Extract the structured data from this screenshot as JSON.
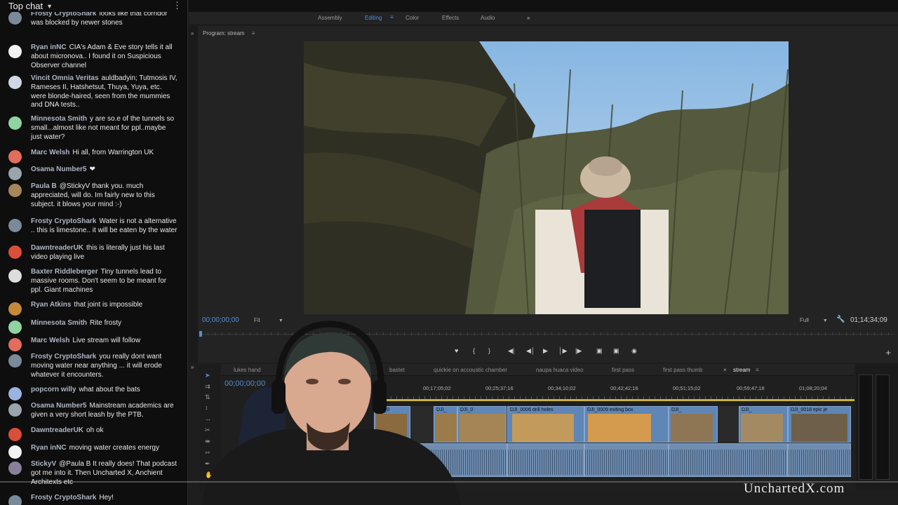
{
  "chat": {
    "header": "Top chat",
    "messages": [
      {
        "author": "Frosty CryptoShark",
        "badge": "",
        "text": "looks like that corridor was blocked by newer stones",
        "color": "#7a8a99"
      },
      {
        "author": "Ryan inNC",
        "text": "CIA's Adam & Eve story tells it all about micronova.. I found it on Suspicious Observer channel",
        "color": "#f2f2f2"
      },
      {
        "author": "Vincit Omnia Veritas",
        "text": "auldbadyin; Tutmosis IV, Rameses II, Hatshetsut, Thuya, Yuya, etc. were blonde-haired, seen from the mummies and DNA tests..",
        "color": "#cfd8e2"
      },
      {
        "author": "Minnesota Smith",
        "text": "y are so.e of the tunnels so small...almost like not meant for ppl..maybe just water?",
        "color": "#8fd3a0"
      },
      {
        "author": "Marc Welsh",
        "text": "Hi all, from Warrington UK",
        "color": "#e26d5c"
      },
      {
        "author": "Osama Number5",
        "text": "❤",
        "color": "#9aa4ad"
      },
      {
        "author": "Paula B",
        "text": "@StickyV thank you. much appreciated, will do. Im fairly new to this subject. it blows your mind :-)",
        "color": "#a8865a"
      },
      {
        "author": "Frosty CryptoShark",
        "text": "Water is not a alternative .. this is limestone.. it will be eaten by the water",
        "color": "#7a8a99"
      },
      {
        "author": "DawntreaderUK",
        "text": "this is literally just his last video playing live",
        "color": "#d94f3a"
      },
      {
        "author": "Baxter Riddleberger",
        "text": "Tiny tunnels lead to massive rooms. Don't seem to be meant for ppl. Giant machines",
        "color": "#dddddd"
      },
      {
        "author": "Ryan Atkins",
        "text": "that joint is impossible",
        "color": "#c48a3a"
      },
      {
        "author": "Minnesota Smith",
        "text": "Rite frosty",
        "color": "#8fd3a0"
      },
      {
        "author": "Marc Welsh",
        "text": "Live stream will follow",
        "color": "#e26d5c"
      },
      {
        "author": "Frosty CryptoShark",
        "text": "you really dont want moving water near anything ... it will erode whatever it encounters.",
        "color": "#7a8a99"
      },
      {
        "author": "popcorn willy",
        "text": "what about the bats",
        "color": "#9bb3e0"
      },
      {
        "author": "Osama Number5",
        "text": "Mainstream academics are given a very short leash by the PTB.",
        "color": "#9aa4ad"
      },
      {
        "author": "DawntreaderUK",
        "text": "oh ok",
        "color": "#d94f3a"
      },
      {
        "author": "Ryan inNC",
        "text": "moving water creates energy",
        "color": "#f2f2f2"
      },
      {
        "author": "StickyV",
        "text": "@Paula B It really does! That podcast got me into it. Then Uncharted X, Anchient Architexts etc",
        "color": "#8a7f9a"
      },
      {
        "author": "Frosty CryptoShark",
        "text": "Hey!",
        "color": "#7a8a99"
      }
    ]
  },
  "workspace": {
    "tabs": [
      "Assembly",
      "Editing",
      "Color",
      "Effects",
      "Audio"
    ],
    "active": "Editing",
    "more": "»"
  },
  "monitor": {
    "title": "Program: stream",
    "timecode_left": "00;00;00;00",
    "fit": "Fit",
    "full": "Full",
    "timecode_right": "01;14;34;09"
  },
  "timeline": {
    "sequences": [
      "lukes hand",
      "bastet",
      "quickie on accoustic chamber",
      "naupa huaca video",
      "first pass",
      "first pass thumb",
      "stream"
    ],
    "active": "stream",
    "timecode": "00;00;00;00",
    "ruler": [
      "00;17;05;02",
      "00;25;37;16",
      "00;34;10;02",
      "00;42;42;16",
      "00;51;15;02",
      "00;59;47;18",
      "01;08;20;04"
    ],
    "clips": [
      "DJI_0",
      "DJI_",
      "DJI_0",
      "DJI_0006 drill holes",
      "DJI_0009 exiting box",
      "DJI_",
      "DJI_",
      "DJI_0018 epic je"
    ]
  },
  "watermark": "UnchartedX.com"
}
